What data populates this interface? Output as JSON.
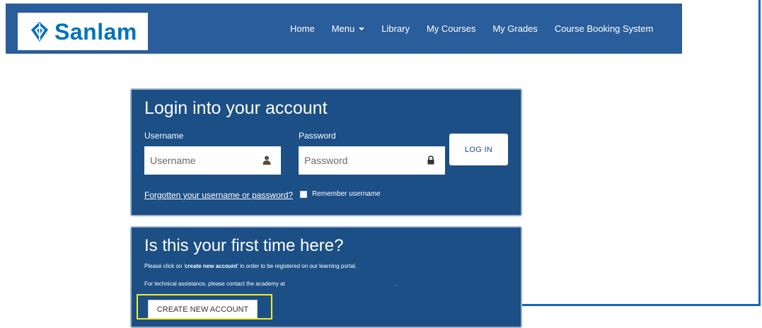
{
  "brand": {
    "name": "Sanlam",
    "logo_icon": "sanlam-shield-icon",
    "logo_color": "#0072bc"
  },
  "navbar": {
    "background": "#2a5d9b",
    "links": [
      {
        "label": "Home"
      },
      {
        "label": "Menu",
        "dropdown": true
      },
      {
        "label": "Library"
      },
      {
        "label": "My Courses"
      },
      {
        "label": "My Grades"
      },
      {
        "label": "Course Booking System"
      }
    ]
  },
  "login": {
    "title": "Login into your account",
    "username_label": "Username",
    "username_placeholder": "Username",
    "username_icon": "user-icon",
    "password_label": "Password",
    "password_placeholder": "Password",
    "password_icon": "lock-icon",
    "login_button": "LOG IN",
    "forgot_link": "Forgotten your username or password?",
    "remember_label": "Remember username",
    "remember_checked": false
  },
  "first_time": {
    "title": "Is this your first time here?",
    "instruction": "Please click on 'create new account' in order to be registered on our learning portal.",
    "instruction_parts": {
      "before": "Please click on '",
      "bold": "create new account",
      "after": "' in order to be registered on our learning portal."
    },
    "assistance": "For technical assistance, please contact the academy at",
    "trailing": ".",
    "create_button": "CREATE NEW ACCOUNT"
  },
  "annotation": {
    "highlight_color": "#f7ec22",
    "arrow_color": "#1565c0"
  }
}
